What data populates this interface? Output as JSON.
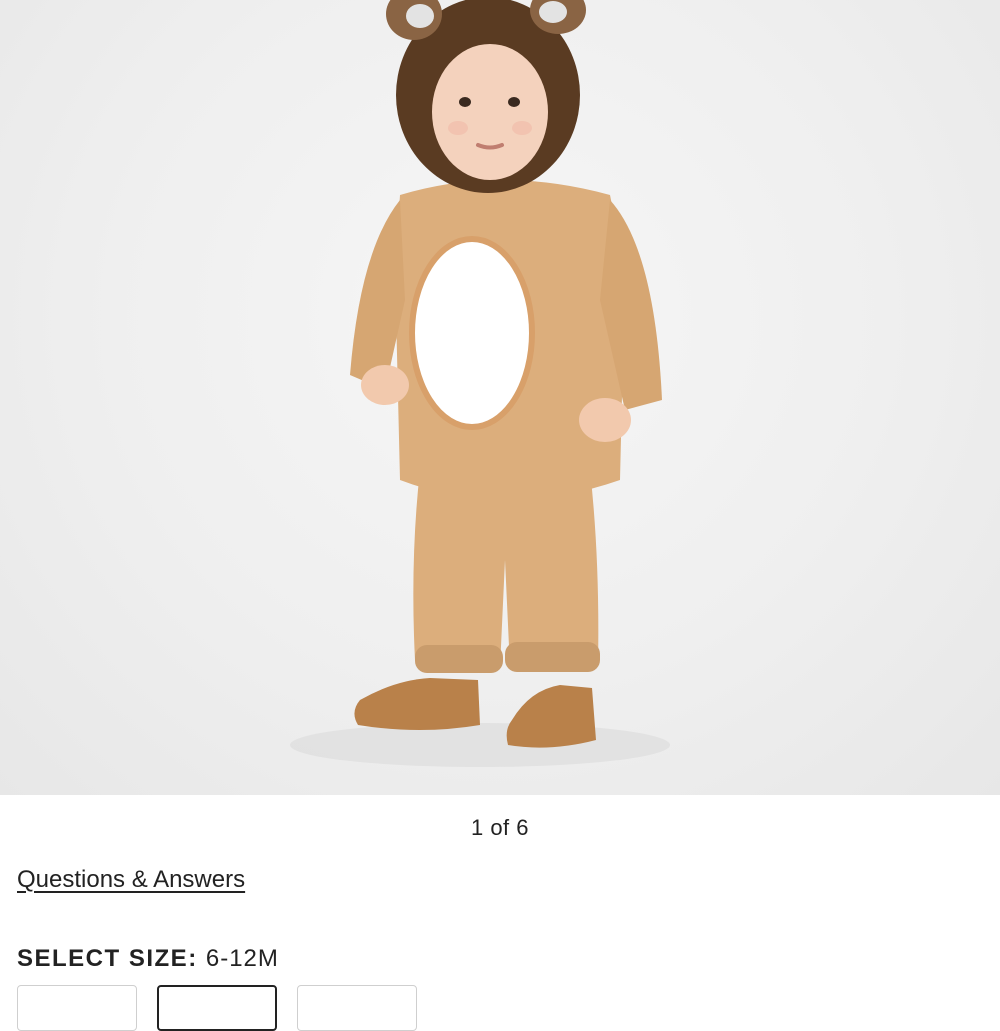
{
  "gallery": {
    "image_alt": "Toddler wearing plush lion costume",
    "pager_text": "1 of 6",
    "current_index": 1,
    "total_images": 6
  },
  "links": {
    "questions_answers": "Questions & Answers"
  },
  "size": {
    "label": "SELECT SIZE:",
    "selected_value": "6-12M",
    "options_visible": 3,
    "selected_option_index": 1
  },
  "colors": {
    "costume": "#dcae7c",
    "mane": "#5a3b22",
    "belly": "#ffffff",
    "boots": "#b9814a",
    "text": "#222222"
  }
}
